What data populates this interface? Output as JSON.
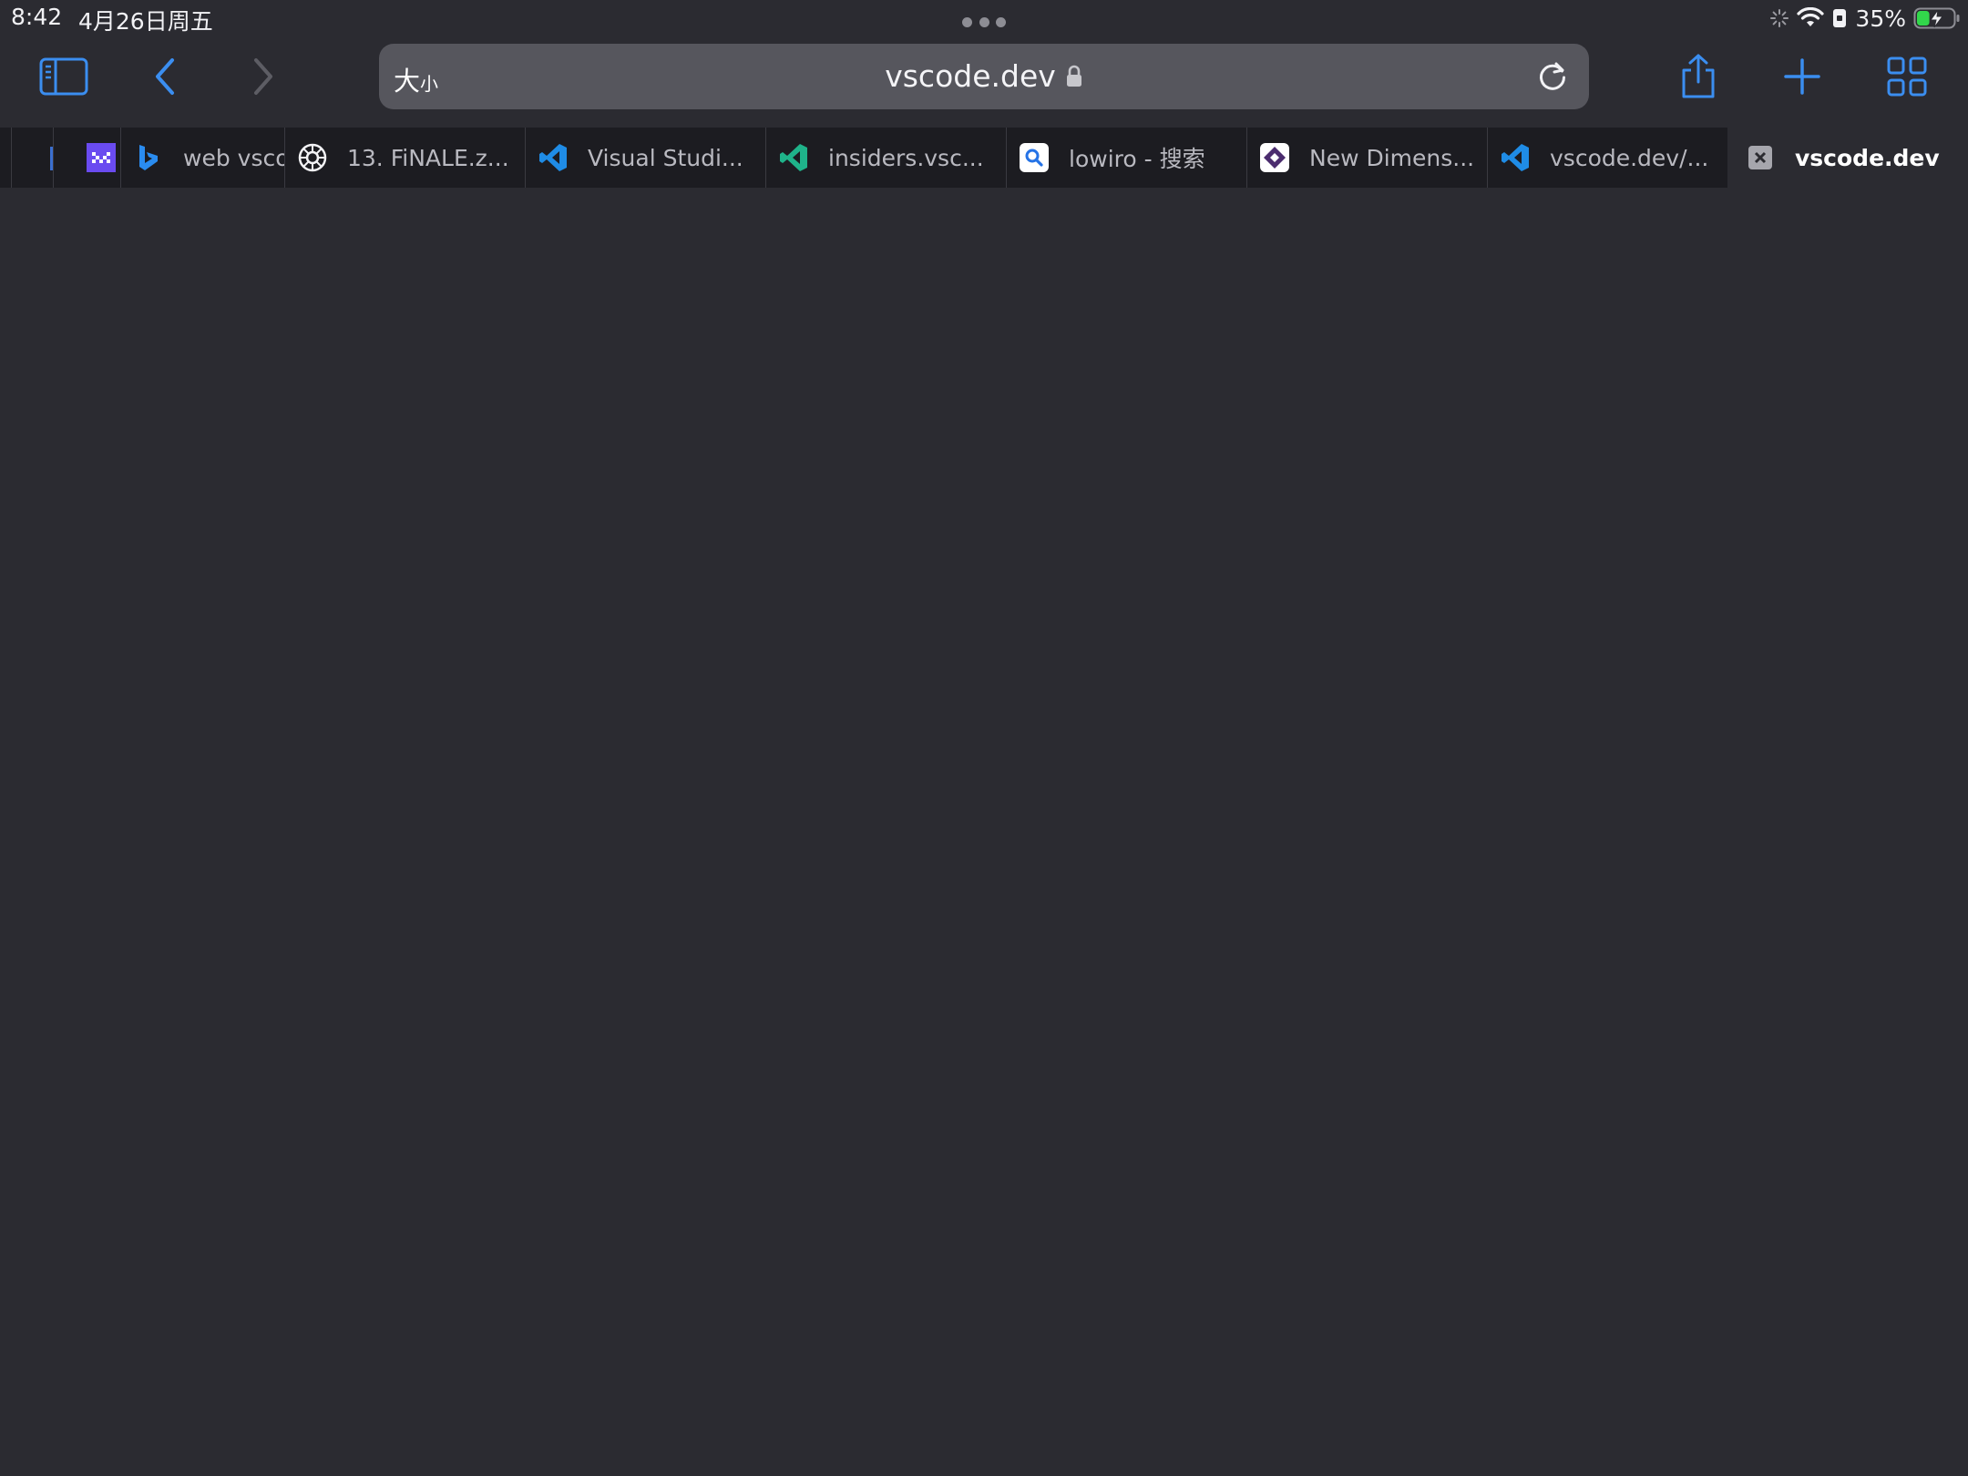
{
  "status_bar": {
    "time": "8:42",
    "date": "4月26日周五",
    "battery_percent": "35%",
    "battery_level": 0.35
  },
  "toolbar": {
    "reader_size_big": "大",
    "reader_size_small": "小",
    "url": "vscode.dev",
    "accent_color": "#3b8ef0"
  },
  "tabs": [
    {
      "title": "",
      "favicon": "blank-icon"
    },
    {
      "title": "",
      "favicon": "purple-logo-icon"
    },
    {
      "title": "web vsco",
      "favicon": "bing-icon"
    },
    {
      "title": "13. FiNALE.z...",
      "favicon": "vinyl-record-icon"
    },
    {
      "title": "Visual Studi...",
      "favicon": "vscode-blue-icon"
    },
    {
      "title": "insiders.vsc...",
      "favicon": "vscode-insiders-icon"
    },
    {
      "title": "lowiro - 搜索",
      "favicon": "search-icon"
    },
    {
      "title": "New Dimens...",
      "favicon": "diamond-logo-icon"
    },
    {
      "title": "vscode.dev/...",
      "favicon": "vscode-blue-icon"
    },
    {
      "title": "vscode.dev",
      "favicon": "close-icon",
      "active": true
    }
  ]
}
